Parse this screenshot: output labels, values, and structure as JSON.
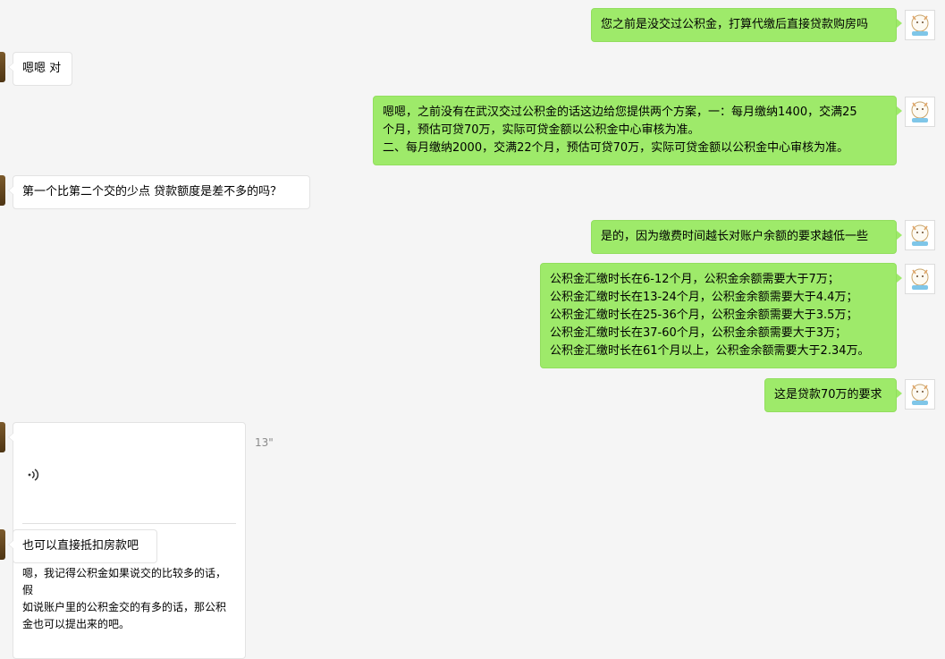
{
  "messages": [
    {
      "side": "right",
      "text": "您之前是没交过公积金，打算代缴后直接贷款购房吗"
    },
    {
      "side": "left",
      "text": "嗯嗯 对"
    },
    {
      "side": "right",
      "text": "嗯嗯，之前没有在武汉交过公积金的话这边给您提供两个方案，一：每月缴纳1400，交满25\n个月，预估可贷70万，实际可贷金额以公积金中心审核为准。\n二、每月缴纳2000，交满22个月，预估可贷70万，实际可贷金额以公积金中心审核为准。"
    },
    {
      "side": "left",
      "text": "第一个比第二个交的少点 贷款额度是差不多的吗？"
    },
    {
      "side": "right",
      "text": "是的，因为缴费时间越长对账户余额的要求越低一些"
    },
    {
      "side": "right",
      "text": "公积金汇缴时长在6-12个月，公积金余额需要大于7万；\n公积金汇缴时长在13-24个月，公积金余额需要大于4.4万；\n公积金汇缴时长在25-36个月，公积金余额需要大于3.5万；\n公积金汇缴时长在37-60个月，公积金余额需要大于3万；\n公积金汇缴时长在61个月以上，公积金余额需要大于2.34万。"
    },
    {
      "side": "right",
      "text": "这是贷款70万的要求"
    },
    {
      "side": "left",
      "type": "voice",
      "duration": "13\"",
      "text": "嗯，我记得公积金如果说交的比较多的话，假\n如说账户里的公积金交的有多的话，那公积\n金也可以提出来的吧。"
    },
    {
      "side": "left",
      "text": "也可以直接抵扣房款吧"
    }
  ]
}
